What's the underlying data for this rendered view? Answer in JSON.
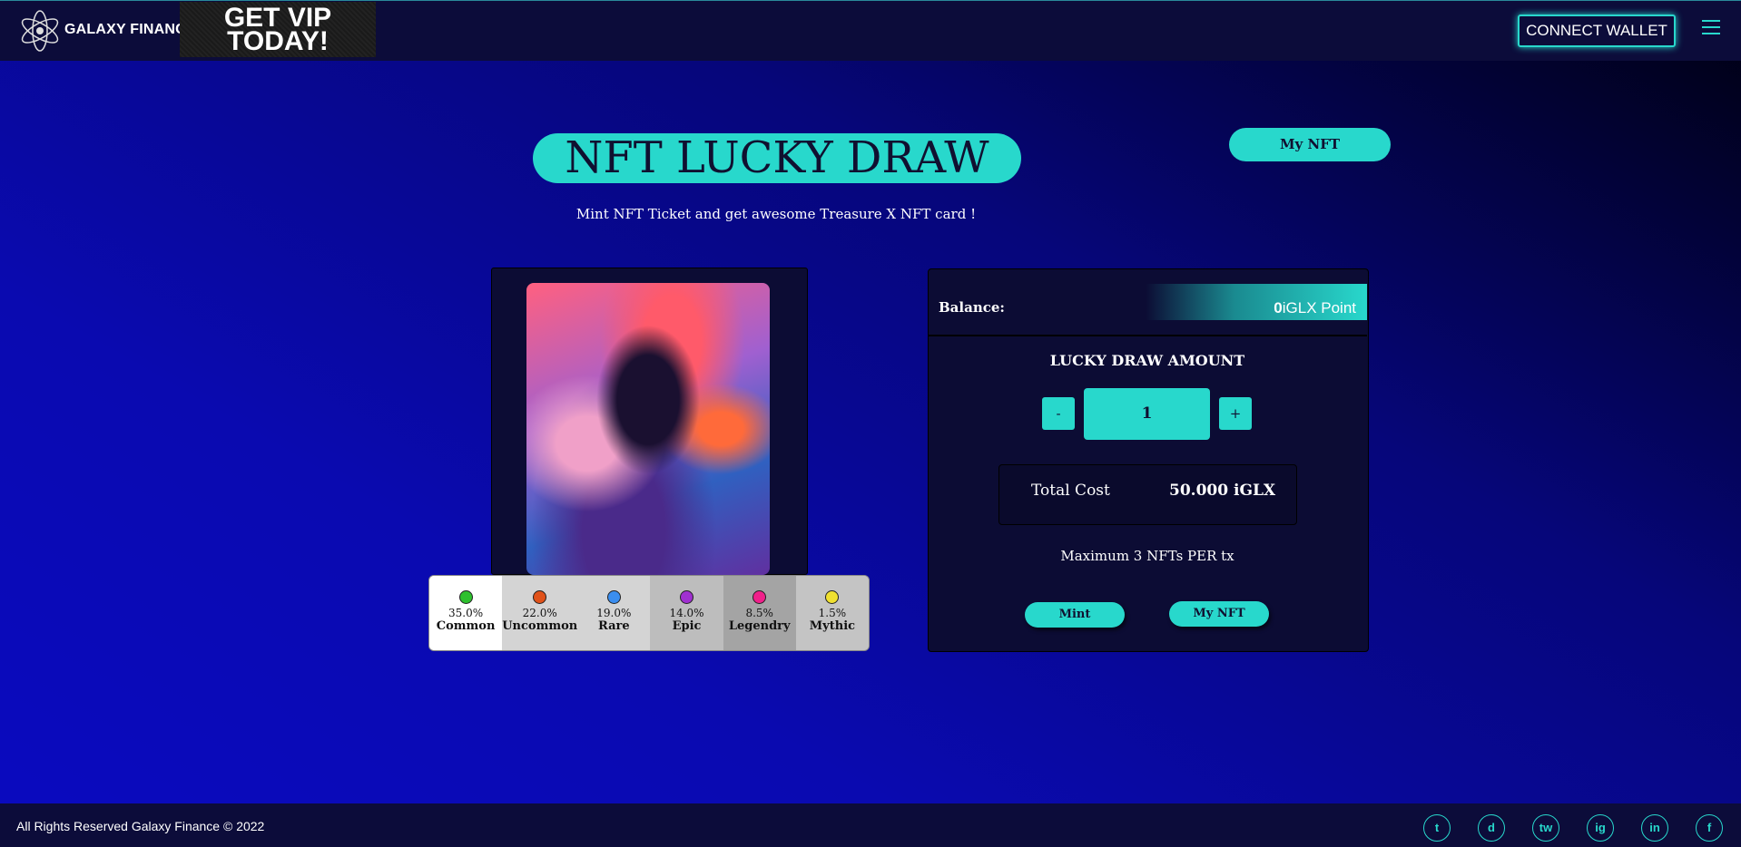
{
  "header": {
    "brand": "GALAXY FINANCE",
    "vip_line1": "GET VIP",
    "vip_line2": "TODAY!",
    "connect_label": "CONNECT WALLET",
    "menu_icon": "hamburger-icon"
  },
  "hero": {
    "title": "NFT LUCKY DRAW",
    "my_nft_label": "My NFT",
    "subtitle": "Mint NFT Ticket and get awesome Treasure X NFT card !"
  },
  "rarity": [
    {
      "pct": "35.0%",
      "name": "Common",
      "color": "#2ec02e",
      "bg": "#ffffff"
    },
    {
      "pct": "22.0%",
      "name": "Uncommon",
      "color": "#e0521a",
      "bg": "#d4d4d4"
    },
    {
      "pct": "19.0%",
      "name": "Rare",
      "color": "#3a8ef0",
      "bg": "#d4d4d4"
    },
    {
      "pct": "14.0%",
      "name": "Epic",
      "color": "#a030d0",
      "bg": "#bdbdbd"
    },
    {
      "pct": "8.5%",
      "name": "Legendry",
      "color": "#f0208a",
      "bg": "#a4a4a4"
    },
    {
      "pct": "1.5%",
      "name": "Mythic",
      "color": "#f0e030",
      "bg": "#c4c4c4"
    }
  ],
  "draw": {
    "balance_label": "Balance:",
    "balance_value": "0",
    "balance_unit": "iGLX Point",
    "amount_label": "LUCKY DRAW AMOUNT",
    "minus": "-",
    "plus": "+",
    "quantity": "1",
    "total_cost_label": "Total Cost",
    "total_cost_value": "50.000",
    "total_cost_unit": "iGLX",
    "max_text": "Maximum 3 NFTs PER tx",
    "mint_label": "Mint",
    "my_nft_label": "My NFT"
  },
  "footer": {
    "copyright": "All Rights Reserved Galaxy Finance © 2022",
    "socials": [
      {
        "icon": "twitter-icon",
        "glyph": "t"
      },
      {
        "icon": "discord-icon",
        "glyph": "d"
      },
      {
        "icon": "twitch-icon",
        "glyph": "tw"
      },
      {
        "icon": "instagram-icon",
        "glyph": "ig"
      },
      {
        "icon": "linkedin-icon",
        "glyph": "in"
      },
      {
        "icon": "facebook-icon",
        "glyph": "f"
      }
    ]
  },
  "colors": {
    "accent": "#28d8cc",
    "panel": "#0c0c34",
    "header": "#0c0c3a"
  }
}
